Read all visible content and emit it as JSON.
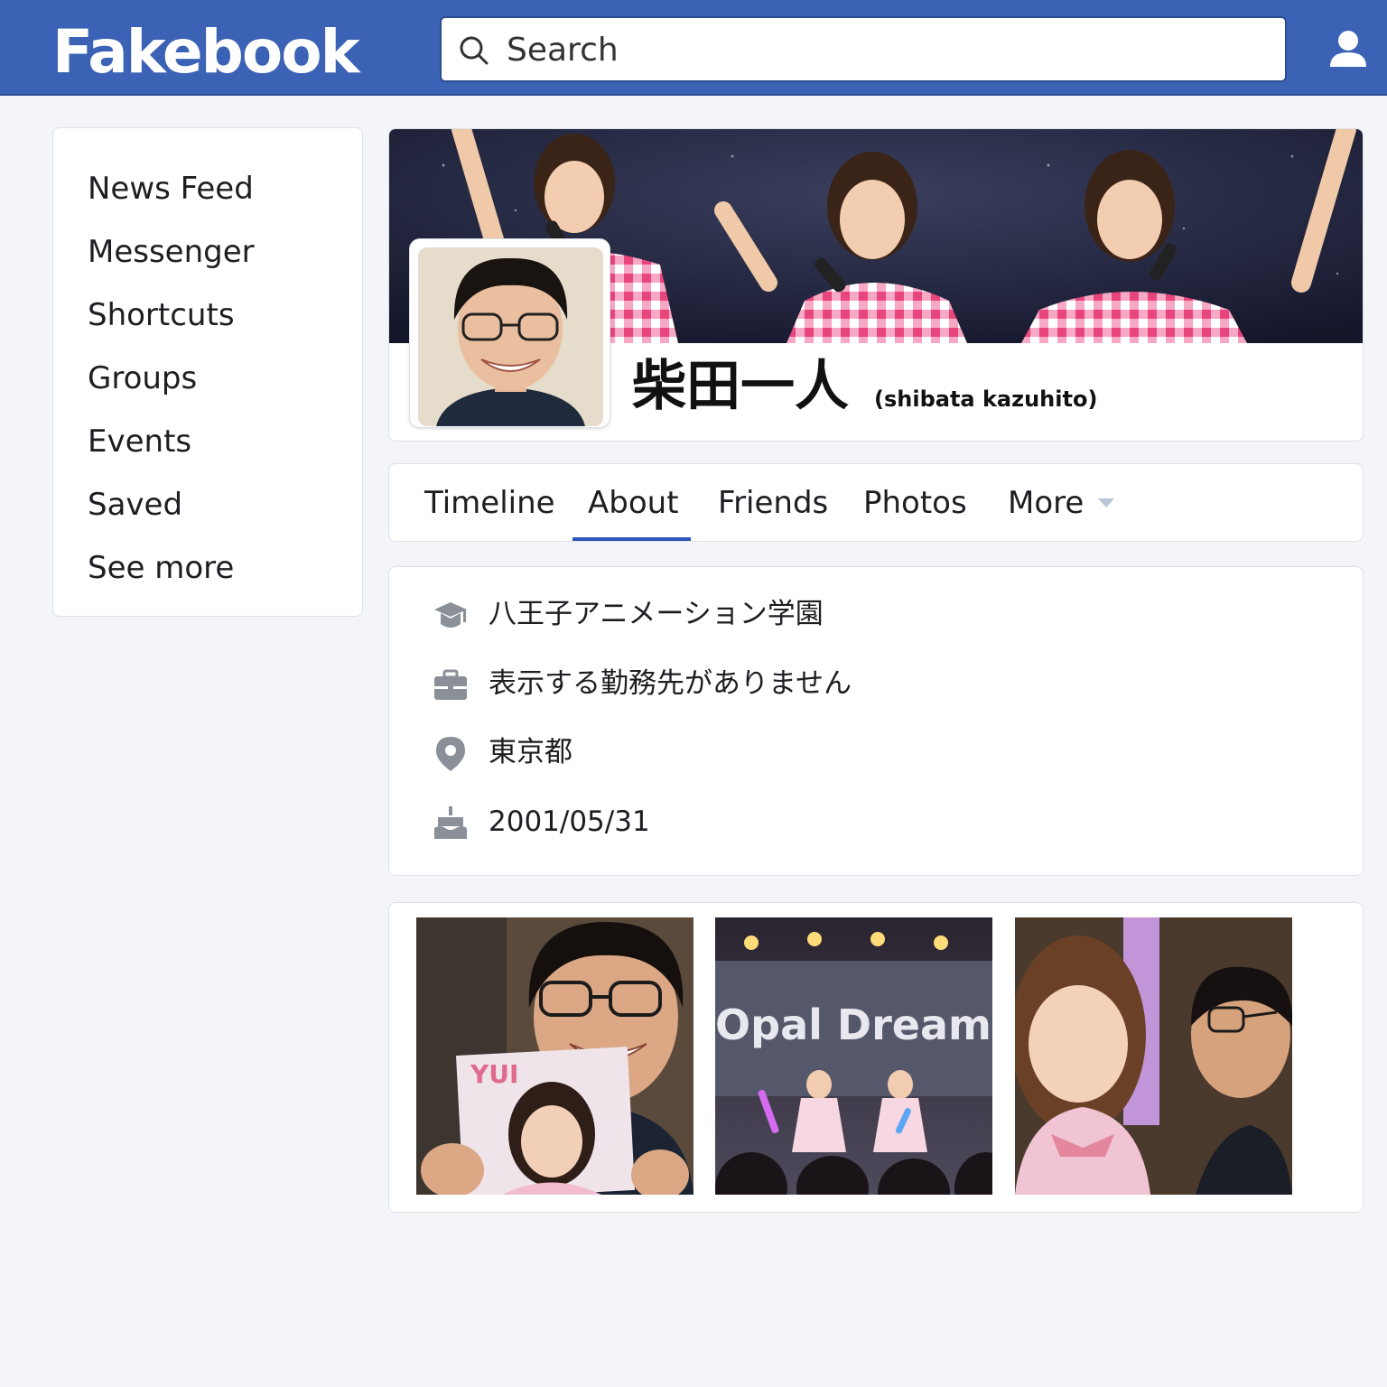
{
  "header": {
    "logo": "Fakebook",
    "search_placeholder": "Search"
  },
  "sidebar": {
    "items": [
      {
        "label": "News Feed"
      },
      {
        "label": "Messenger"
      },
      {
        "label": "Shortcuts"
      },
      {
        "label": "Groups"
      },
      {
        "label": "Events"
      },
      {
        "label": "Saved"
      },
      {
        "label": "See more"
      }
    ]
  },
  "profile": {
    "name": "柴田一人",
    "romaji": "(shibata kazuhito)"
  },
  "tabs": {
    "items": [
      {
        "label": "Timeline"
      },
      {
        "label": "About"
      },
      {
        "label": "Friends"
      },
      {
        "label": "Photos"
      },
      {
        "label": "More"
      }
    ],
    "active": "About"
  },
  "about": {
    "items": [
      {
        "icon": "graduation-cap-icon",
        "text": "八王子アニメーション学園"
      },
      {
        "icon": "briefcase-icon",
        "text": "表示する勤務先がありません"
      },
      {
        "icon": "location-pin-icon",
        "text": "東京都"
      },
      {
        "icon": "birthday-cake-icon",
        "text": "2001/05/31"
      }
    ]
  },
  "photos": {
    "items": [
      {
        "poster_text": "YUI"
      },
      {
        "banner_text": "Opal Dream"
      },
      {}
    ]
  },
  "colors": {
    "brand": "#3b62b5",
    "tab_active": "#2f56b8",
    "background": "#f3f5f9",
    "icon_gray": "#8a8f98"
  }
}
